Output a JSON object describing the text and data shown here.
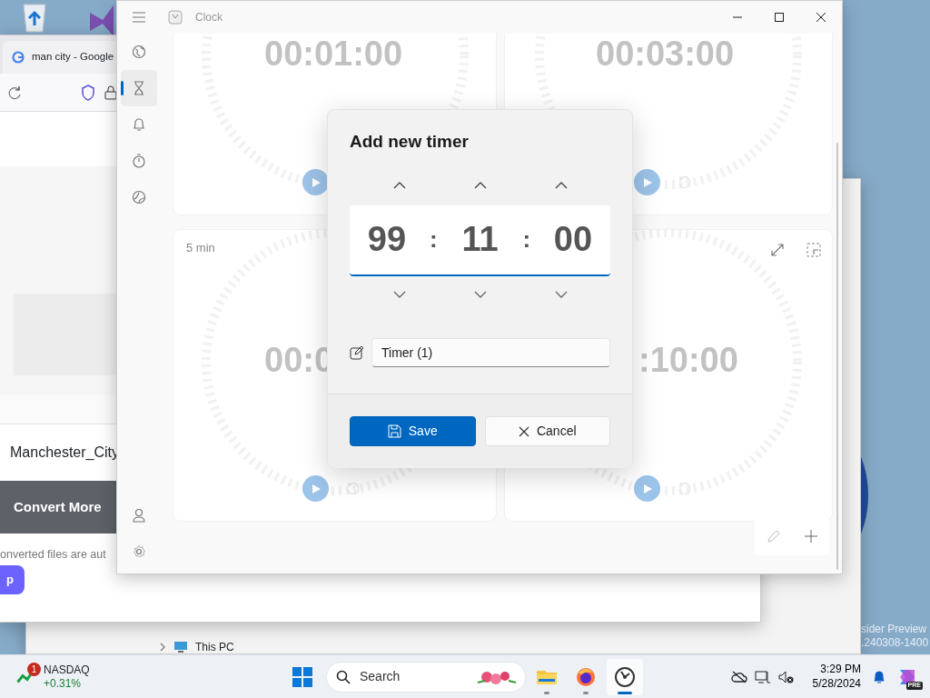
{
  "desktop": {
    "watermark": [
      "sider Preview",
      ".240308-1400"
    ]
  },
  "explorer": {
    "tree_item": "This PC"
  },
  "browser": {
    "tab_title": "man city - Google",
    "file_name": "Manchester_City",
    "convert_button": "Convert More",
    "note": "onverted files are aut",
    "side_button": "p"
  },
  "clock": {
    "title": "Clock",
    "nav": [
      {
        "kind": "world",
        "selected": false
      },
      {
        "kind": "timer",
        "selected": true
      },
      {
        "kind": "alarm",
        "selected": false
      },
      {
        "kind": "stopwatch",
        "selected": false
      },
      {
        "kind": "focus",
        "selected": false
      }
    ],
    "nav_bottom": [
      {
        "kind": "account"
      },
      {
        "kind": "settings"
      }
    ],
    "timers": [
      {
        "time": "00:01:00"
      },
      {
        "time": "00:03:00"
      },
      {
        "name": "5 min",
        "time": "00:0"
      },
      {
        "time": ":10:00",
        "actions": true
      }
    ],
    "dialog": {
      "title": "Add new timer",
      "fields": [
        {
          "value": "99"
        },
        {
          "value": "11"
        },
        {
          "value": "00"
        }
      ],
      "separators": [
        ":",
        ":"
      ],
      "name_value": "Timer (1)",
      "save": "Save",
      "cancel": "Cancel"
    }
  },
  "taskbar": {
    "widget": {
      "name": "NASDAQ",
      "change": "+0.31%",
      "badge": "1"
    },
    "search_placeholder": "Search",
    "apps": [
      {
        "kind": "explorer",
        "active": false
      },
      {
        "kind": "firefox",
        "active": false
      },
      {
        "kind": "clock",
        "active": true
      }
    ],
    "time": "3:29 PM",
    "date": "5/28/2024",
    "copilot_badge": "PRE"
  }
}
